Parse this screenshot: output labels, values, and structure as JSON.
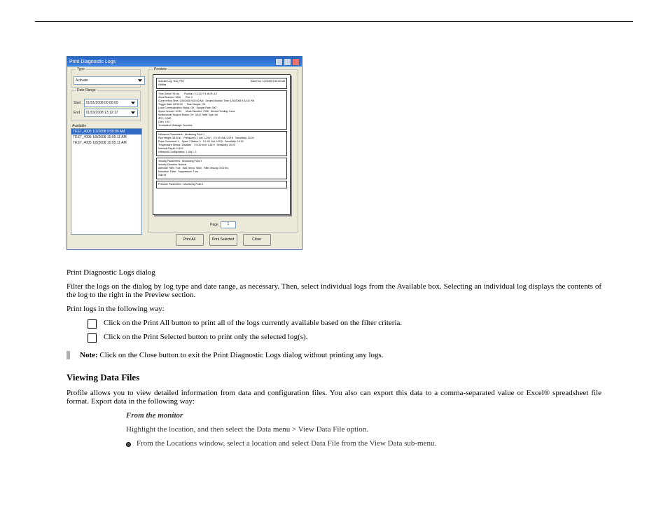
{
  "window": {
    "title": "Print Diagnostic Logs",
    "type_label": "Type",
    "type_value": "Activate",
    "date_range_label": "Date Range",
    "start_label": "Start",
    "start_value": "01/01/2008 00:00:00",
    "end_label": "End",
    "end_value": "01/03/2008 13:12:17",
    "available_label": "Available",
    "available": [
      "TEST_4005   1/2/2008 9:50:00 AM",
      "TEST_4005   1/8/2008 10:05:11 AM",
      "TEST_4005   1/8/2008 10:05:11 AM"
    ],
    "preview_label": "Preview",
    "page_label": "Page",
    "page_value": "1",
    "buttons": {
      "print_all": "Print All",
      "print_selected": "Print Selected",
      "close": "Close"
    }
  },
  "preview": {
    "header": {
      "title": "Activate Log: Test_PRO",
      "date": "Date/One: 1/2/2008 9:50:00 AM",
      "sub": "Utilities"
    },
    "info": "Time Online: 91 ms       Position: X:1.03, P:1.60,R:-4.2\\nSerial Number: 4006       Port: 0\\nCurrent Host Time: 1/30/2008 9:02:00 AM   Desired Monitor Time: 1/30/2008 9:33:31 PM\\nTrigger Start: 00:00:00      Fast Sample: Off\\nLocal Communication Status: OK   Sample Rate: 300\\nSpace Version: 10.54      Model Number: 7906   Device Pending: None\\nMultichannel Support Status: On   MUX Table Type: All\\nSR 1: 0:300\\nGain: 1:30\\nTermination Message: Success",
    "ultra": "Ultrasonic Parameters · Monitoring Point 1\\nPipe Height: 36.00 in    Pressure(0-1 Volt: 1.20V)   X:0.00 Volt: 0.00 ft   Sensitivity: 10.00\\nPulse Command: 4    Spare 2 Status: 0   X:1.00 Volt: 0.00 ft   Sensitivity: 10.00\\nTemperature Sensor: Disabled    X:0.00 Inch: 0.82 ft   Sensitivity: 20.00\\nManhole Depth: 0.00 ft\\nUltrasonic Configuration: 1, Adj 1, 1",
    "vel": "Velocity Parameters · Monitoring Point 1\\nVelocity Direction: Normal\\nAlternate Filter: True   Max: Iterno: 9600   Filter Velocity: 8.00 ft/s\\nMaxvalue: False   Suppression: True\\nGain M",
    "press": "Pressure Parameters · Monitoring Point 1"
  },
  "doc": {
    "caption": "Print Diagnostic Logs dialog",
    "p1": "Filter the logs on the dialog by log type and date range, as necessary. Then, select individual logs from the Available box. Selecting an individual log displays the contents of the log to the right in the Preview section.",
    "p2": "Print logs in the following way:",
    "check1": "Click on the Print All button to print all of the logs currently available based on the filter criteria.",
    "check2": "Click on the Print Selected button to print only the selected log(s).",
    "note_label": "Note:",
    "note": "Click on the Close button to exit the Print Diagnostic Logs dialog without printing any logs.",
    "h1": "Viewing Data Files",
    "p3": "Profile allows you to view detailed information from data and configuration files. You also can export this data to a comma-separated value or Excel® spreadsheet file format. Export data in the following way:",
    "sub_h": "From the monitor",
    "sub_p": "Highlight the location, and then select the Data menu > View Data File option.",
    "bullet1": "From the Locations window, select a location and select Data File from the View Data sub-menu."
  }
}
